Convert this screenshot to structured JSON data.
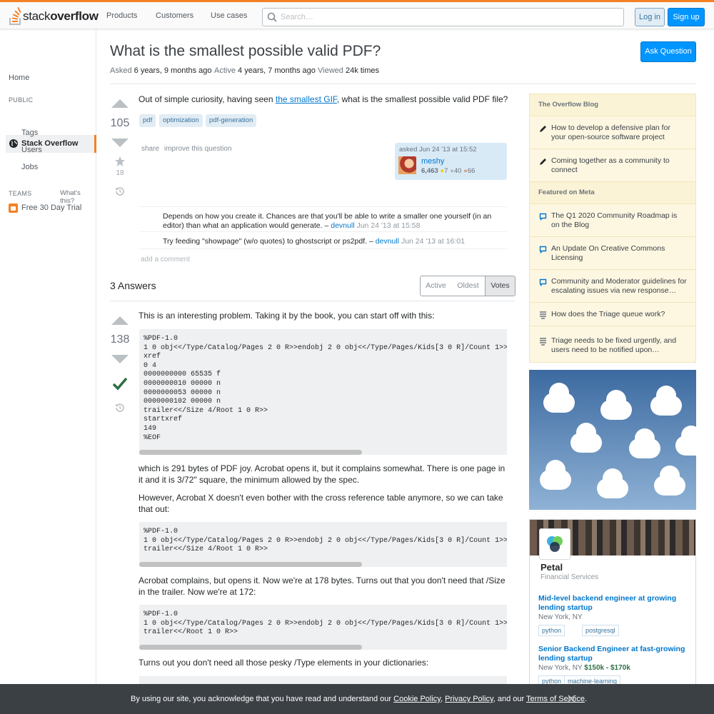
{
  "header": {
    "logo_text_light": "stack",
    "logo_text_bold": "overflow",
    "nav": [
      "Products",
      "Customers",
      "Use cases"
    ],
    "search_placeholder": "Search…",
    "login": "Log in",
    "signup": "Sign up"
  },
  "leftnav": {
    "home": "Home",
    "public": "PUBLIC",
    "stack_overflow": "Stack Overflow",
    "tags": "Tags",
    "users": "Users",
    "jobs": "Jobs",
    "teams": "TEAMS",
    "whats_this": "What's this?",
    "trial": "Free 30 Day Trial"
  },
  "question": {
    "title": "What is the smallest possible valid PDF?",
    "ask_button": "Ask Question",
    "asked_label": "Asked",
    "asked_value": "6 years, 9 months ago",
    "active_label": "Active",
    "active_value": "4 years, 7 months ago",
    "viewed_label": "Viewed",
    "viewed_value": "24k times",
    "votes": "105",
    "favorites": "18",
    "text_before": "Out of simple curiosity, having seen ",
    "link": "the smallest GIF",
    "text_after": ", what is the smallest possible valid PDF file?",
    "tags": [
      "pdf",
      "optimization",
      "pdf-generation"
    ],
    "share": "share",
    "improve": "improve this question",
    "owner_asked": "asked Jun 24 '13 at 15:52",
    "owner_name": "meshy",
    "owner_rep": "6,463",
    "badge_gold": "7",
    "badge_silver": "40",
    "badge_bronze": "66"
  },
  "comments": [
    {
      "text": "Depends on how you create it. Chances are that you'll be able to write a smaller one yourself (in an editor) than what an application would generate. –",
      "user": "devnull",
      "date": "Jun 24 '13 at 15:58"
    },
    {
      "text": "Try feeding \"showpage\" (w/o quotes) to ghostscript or ps2pdf. –",
      "user": "devnull",
      "date": "Jun 24 '13 at 16:01"
    }
  ],
  "add_comment": "add a comment",
  "answers": {
    "heading": "3 Answers",
    "sort": [
      "Active",
      "Oldest",
      "Votes"
    ],
    "votes": "138",
    "intro": "This is an interesting problem. Taking it by the book, you can start off with this:",
    "code1": "%PDF-1.0\n1 0 obj<</Type/Catalog/Pages 2 0 R>>endobj 2 0 obj<</Type/Pages/Kids[3 0 R]/Count 1>>\nxref\n0 4\n0000000000 65535 f\n0000000010 00000 n\n0000000053 00000 n\n0000000102 00000 n\ntrailer<</Size 4/Root 1 0 R>>\nstartxref\n149\n%EOF",
    "p1": "which is 291 bytes of PDF joy. Acrobat opens it, but it complains somewhat. There is one page in it and it is 3/72\" square, the minimum allowed by the spec.",
    "p2": "However, Acrobat X doesn't even bother with the cross reference table anymore, so we can take that out:",
    "code2": "%PDF-1.0\n1 0 obj<</Type/Catalog/Pages 2 0 R>>endobj 2 0 obj<</Type/Pages/Kids[3 0 R]/Count 1>>\ntrailer<</Size 4/Root 1 0 R>>",
    "p3": "Acrobat complains, but opens it. Now we're at 178 bytes. Turns out that you don't need that /Size in the trailer. Now we're at 172:",
    "code3": "%PDF-1.0\n1 0 obj<</Type/Catalog/Pages 2 0 R>>endobj 2 0 obj<</Type/Pages/Kids[3 0 R]/Count 1>>\ntrailer<</Root 1 0 R>>",
    "p4": "Turns out you don't need all those pesky /Type elements in your dictionaries:"
  },
  "sidebar": {
    "blog_head": "The Overflow Blog",
    "blog": [
      "How to develop a defensive plan for your open-source software project",
      "Coming together as a community to connect"
    ],
    "meta_head": "Featured on Meta",
    "meta": [
      "The Q1 2020 Community Roadmap is on the Blog",
      "An Update On Creative Commons Licensing",
      "Community and Moderator guidelines for escalating issues via new response…",
      "How does the Triage queue work?",
      "Triage needs to be fixed urgently, and users need to be notified upon…"
    ]
  },
  "jobs": {
    "company": "Petal",
    "industry": "Financial Services",
    "list": [
      {
        "title": "Mid-level backend engineer at growing lending startup",
        "location": "New York, NY",
        "salary": "",
        "tags": [
          "python",
          "postgresql"
        ]
      },
      {
        "title": "Senior Backend Engineer at fast-growing lending startup",
        "location": "New York, NY",
        "salary": "$150k - $170k",
        "tags": [
          "python",
          "machine-learning"
        ]
      }
    ]
  },
  "cookie": {
    "text1": "By using our site, you acknowledge that you have read and understand our ",
    "cookie_policy": "Cookie Policy",
    "sep": ", ",
    "privacy_policy": "Privacy Policy",
    "text2": ", and our ",
    "terms": "Terms of Service",
    "end": "."
  },
  "colors": {
    "accent": "#f48024",
    "link": "#0077cc",
    "primary_button": "#0095ff",
    "accepted": "#2f6f44"
  }
}
